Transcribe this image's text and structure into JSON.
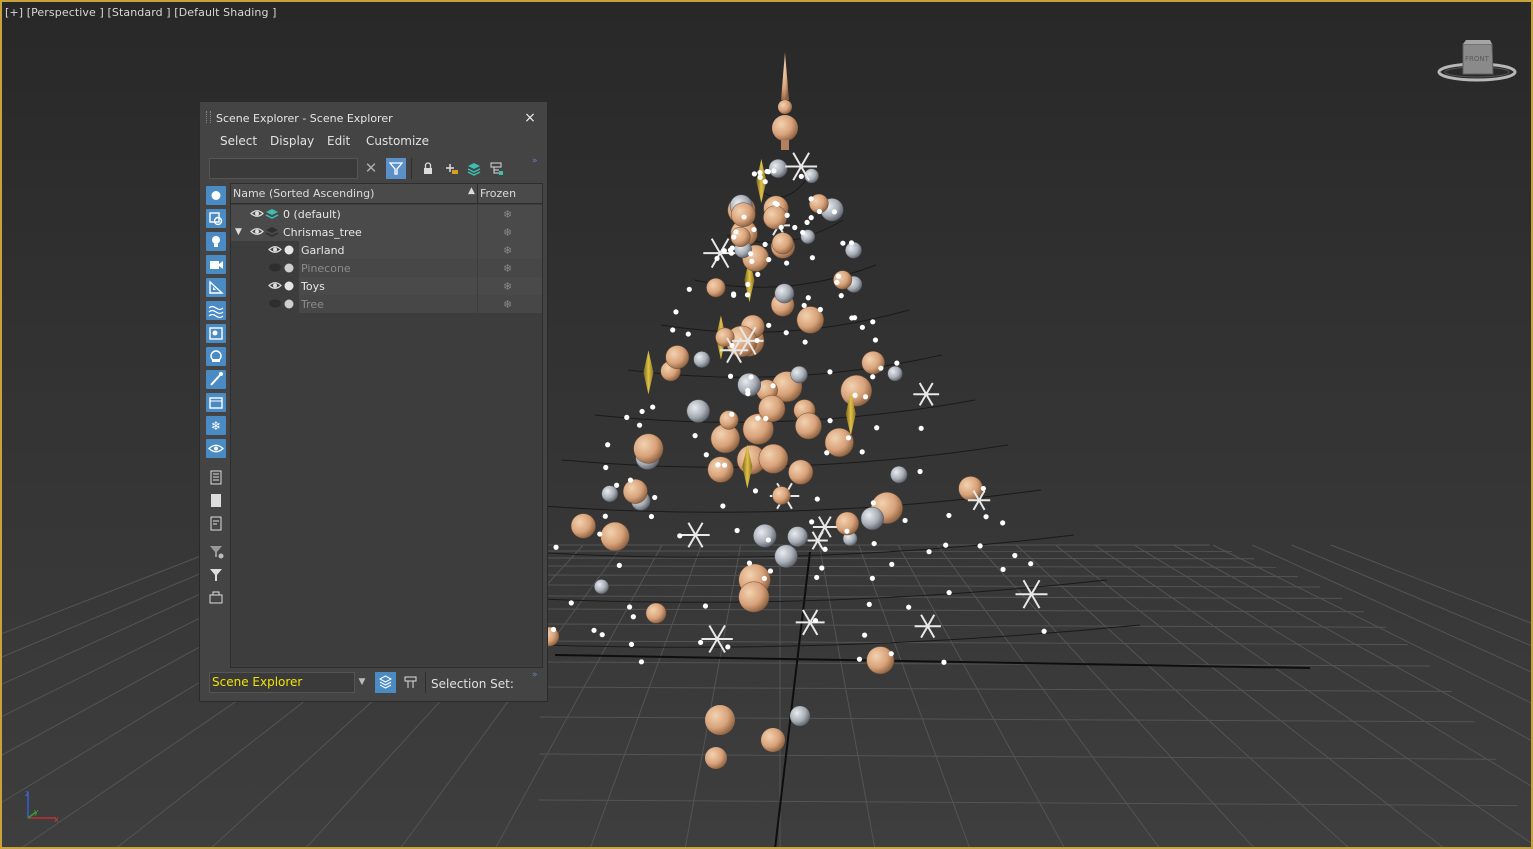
{
  "viewport": {
    "label": "[+] [Perspective ] [Standard ] [Default Shading ]",
    "nav_cube_face": "FRONT",
    "axis_labels": {
      "x": "x",
      "y": "y",
      "z": "z"
    }
  },
  "scene_explorer": {
    "title": "Scene Explorer - Scene Explorer",
    "close_label": "×",
    "menu": [
      "Select",
      "Display",
      "Edit",
      "Customize"
    ],
    "search_value": "",
    "columns": {
      "name": "Name (Sorted Ascending)",
      "sort_indicator": "▲",
      "frozen": "Frozen"
    },
    "rows": [
      {
        "label": "0 (default)",
        "visible": true,
        "level": 0,
        "type": "layer-active"
      },
      {
        "label": "Chrismas_tree",
        "visible": true,
        "level": 0,
        "type": "layer",
        "expanded": true
      },
      {
        "label": "Garland",
        "visible": true,
        "level": 1,
        "type": "object"
      },
      {
        "label": "Pinecone",
        "visible": false,
        "level": 1,
        "type": "object"
      },
      {
        "label": "Toys",
        "visible": true,
        "level": 1,
        "type": "object"
      },
      {
        "label": "Tree",
        "visible": false,
        "level": 1,
        "type": "object"
      }
    ],
    "explorer_select": "Scene Explorer",
    "selection_set_label": "Selection Set:",
    "left_tools": [
      "display-geometry-icon",
      "display-shapes-icon",
      "display-lights-icon",
      "display-cameras-icon",
      "display-helpers-icon",
      "display-spacewarps-icon",
      "display-groups-icon",
      "display-xrefs-icon",
      "display-bones-icon",
      "display-containers-icon",
      "display-frozen-icon",
      "display-hidden-icon",
      "display-all-icon",
      "display-none-icon",
      "invert-display-icon",
      "filter-settings-icon",
      "filter-icon",
      "lock-cell-icon"
    ]
  },
  "colors": {
    "accent": "#4b8bc4",
    "viewport_border": "#c8a23a",
    "explorer_text": "#f2e400"
  }
}
